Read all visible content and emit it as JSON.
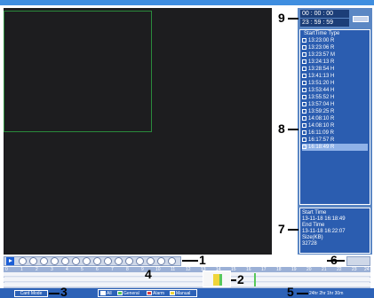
{
  "time_panel": {
    "start_time": "00 : 00 : 00",
    "end_time": "23 : 59 : 59"
  },
  "file_list": {
    "header": "StartTime Type",
    "rows": [
      {
        "time": "13:23:00",
        "type": "R"
      },
      {
        "time": "13:23:06",
        "type": "R"
      },
      {
        "time": "13:23:57",
        "type": "M"
      },
      {
        "time": "13:24:13",
        "type": "R"
      },
      {
        "time": "13:28:54",
        "type": "H"
      },
      {
        "time": "13:41:13",
        "type": "H"
      },
      {
        "time": "13:51:20",
        "type": "H"
      },
      {
        "time": "13:53:44",
        "type": "H"
      },
      {
        "time": "13:55:52",
        "type": "H"
      },
      {
        "time": "13:57:04",
        "type": "H"
      },
      {
        "time": "13:59:25",
        "type": "R"
      },
      {
        "time": "14:08:10",
        "type": "R"
      },
      {
        "time": "14:08:10",
        "type": "R"
      },
      {
        "time": "16:11:09",
        "type": "R"
      },
      {
        "time": "16:17:57",
        "type": "R"
      },
      {
        "time": "16:18:49",
        "type": "R"
      }
    ]
  },
  "file_info": {
    "start_label": "Start Time",
    "start_value": "13-11-18 16:18:49",
    "end_label": "End Time",
    "end_value": "13-11-18 16:22:07",
    "size_label": "Size(KB)",
    "size_value": "32728"
  },
  "timeline": {
    "ticks": [
      "0",
      "1",
      "2",
      "3",
      "4",
      "5",
      "6",
      "7",
      "8",
      "9",
      "10",
      "11",
      "12",
      "13",
      "14",
      "15",
      "16",
      "17",
      "18",
      "19",
      "20",
      "21",
      "22",
      "23",
      "24"
    ]
  },
  "bottom_bar": {
    "mode_button": "Card Mode",
    "legend": [
      "All",
      "General",
      "Alarm",
      "Manual"
    ],
    "right_buttons": "24hr 2hr 1hr 30m"
  },
  "callouts": {
    "c1": "1",
    "c2": "2",
    "c3": "3",
    "c4": "4",
    "c5": "5",
    "c6": "6",
    "c7": "7",
    "c8": "8",
    "c9": "9"
  },
  "colors": {
    "accent_blue": "#2d62b7",
    "record_general": "#58c85a",
    "record_alarm": "#e04040",
    "record_manual": "#f0d53a"
  }
}
